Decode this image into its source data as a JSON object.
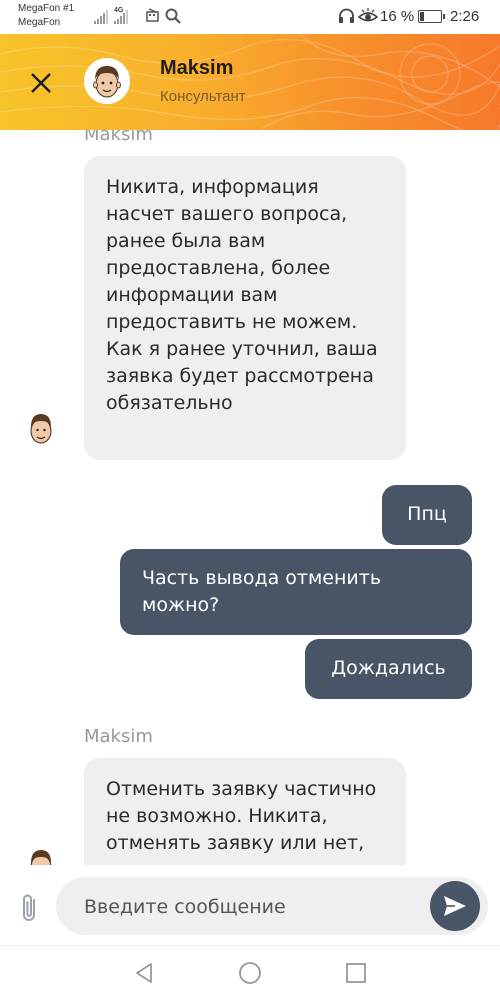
{
  "status_bar": {
    "carrier_1": "MegaFon #1",
    "carrier_2": "MegaFon",
    "network_tag": "4G",
    "battery_text": "16 %",
    "time": "2:26",
    "icons": [
      "signal-icon",
      "signal-icon",
      "sim-icon",
      "search-icon",
      "headphones-icon",
      "eye-icon",
      "battery-icon"
    ]
  },
  "header": {
    "name": "Maksim",
    "role": "Консультант",
    "close_icon": "close-icon",
    "accent_colors": [
      "#f7c42a",
      "#f6792b"
    ]
  },
  "chat": {
    "messages": [
      {
        "direction": "incoming",
        "sender": "Maksim",
        "text": "Никита, информация насчет вашего вопроса, ранее была вам предоставлена, более информации вам предоставить не можем. Как я ранее уточнил, ваша заявка будет рассмотрена обязательно"
      },
      {
        "direction": "outgoing",
        "text": "Ппц"
      },
      {
        "direction": "outgoing",
        "text": "Часть вывода отменить можно?"
      },
      {
        "direction": "outgoing",
        "text": "Дождались"
      },
      {
        "direction": "incoming",
        "sender": "Maksim",
        "text": "Отменить заявку частично не возможно. Никита, отменять заявку или нет, решение игрока"
      }
    ],
    "incoming_bg": "#efefef",
    "outgoing_bg": "#485566"
  },
  "composer": {
    "placeholder": "Введите сообщение",
    "value": "",
    "attach_icon": "paperclip-icon",
    "send_icon": "send-icon"
  },
  "nav_bar": {
    "icons": [
      "back-icon",
      "home-icon",
      "recents-icon"
    ]
  }
}
